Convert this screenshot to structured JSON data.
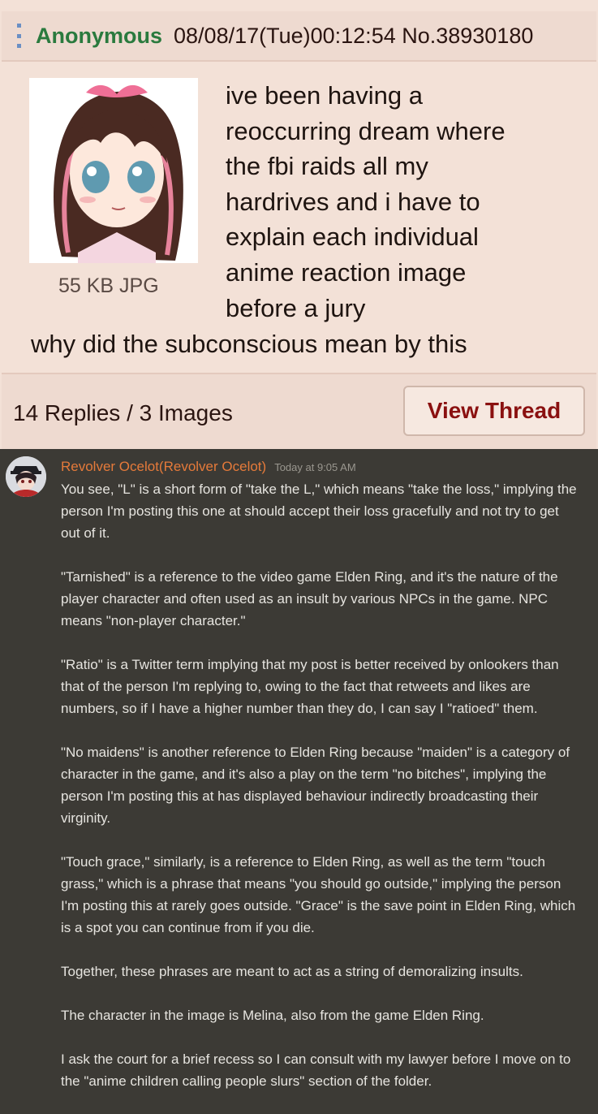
{
  "post": {
    "name": "Anonymous",
    "meta": "08/08/17(Tue)00:12:54 No.38930180",
    "file_info": "55 KB JPG",
    "lines": [
      "ive been having a",
      "reoccurring dream where",
      "the fbi raids all my",
      "hardrives and i have to",
      "explain each individual",
      "anime reaction image",
      "before a jury"
    ],
    "last_line": "why did the subconscious mean by this",
    "replies": "14 Replies / 3 Images",
    "view_thread": "View Thread"
  },
  "message": {
    "author": "Revolver Ocelot(Revolver Ocelot)",
    "timestamp": "Today at 9:05 AM",
    "paragraphs": [
      "You see, \"L\" is a short form of \"take the L,\" which means \"take the loss,\" implying the person I'm posting this one at should accept their loss gracefully and not try to get out of it.",
      "\"Tarnished\" is a reference to the video game Elden Ring, and it's the nature of the player character and often used as an insult by various NPCs in the game. NPC means \"non-player character.\"",
      "\"Ratio\" is a Twitter term implying that my post is better received by onlookers than that of the person I'm replying to, owing to the fact that retweets and likes are numbers, so if I have a higher number than they do, I can say I \"ratioed\" them.",
      "\"No maidens\" is another reference to Elden Ring because \"maiden\" is a category of character in the game, and it's also a play on the term \"no bitches\", implying the person I'm posting this at has displayed behaviour indirectly broadcasting their virginity.",
      "\"Touch grace,\" similarly, is a reference to Elden Ring, as well as the term \"touch grass,\" which is a phrase that means \"you should go outside,\" implying the person I'm posting this at rarely goes outside. \"Grace\" is the save point in Elden Ring, which is a spot you can continue from if you die.",
      "Together, these phrases are meant to act as a string of demoralizing insults.",
      "The character in the image is Melina, also from the game Elden Ring.",
      "I ask the court for a brief recess so I can consult with my lawyer before I move on to the \"anime children calling people slurs\" section of the folder."
    ]
  },
  "colors": {
    "name_green": "#2a7a3e",
    "post_bg": "#f3e1d7",
    "button_text": "#8a1010",
    "chat_bg": "#3c3a35",
    "author_orange": "#e57a3a"
  },
  "icons": {
    "menu": "vertical-dots-menu-icon"
  }
}
